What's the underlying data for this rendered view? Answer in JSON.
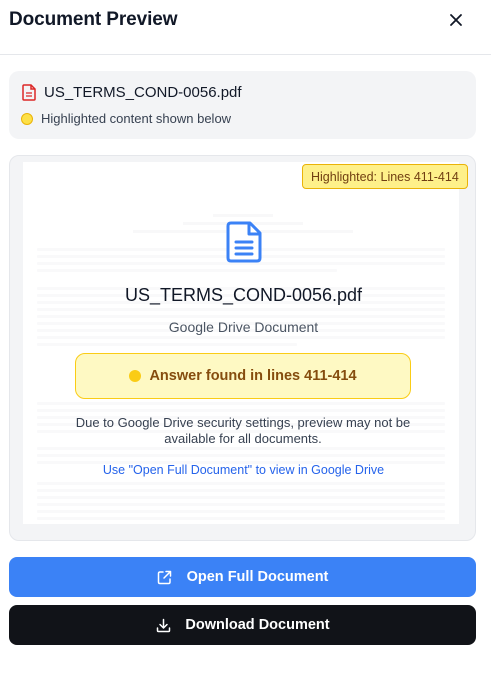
{
  "header": {
    "title": "Document Preview"
  },
  "file": {
    "name": "US_TERMS_COND-0056.pdf",
    "highlight_note": "Highlighted content shown below"
  },
  "preview": {
    "badge": "Highlighted: Lines 411-414",
    "doc_title": "US_TERMS_COND-0056.pdf",
    "doc_subtitle": "Google Drive Document",
    "answer": "Answer found in lines 411-414",
    "note": "Due to Google Drive security settings, preview may not be available for all documents.",
    "link": "Use \"Open Full Document\" to view in Google Drive"
  },
  "actions": {
    "open_label": "Open Full Document",
    "download_label": "Download Document"
  },
  "colors": {
    "primary": "#3b82f6",
    "dark": "#111318",
    "highlight": "#fef08a",
    "pdf_red": "#dc2626"
  },
  "icons": {
    "close": "close-icon",
    "file": "pdf-file-icon",
    "doc": "document-icon",
    "open": "external-link-icon",
    "download": "download-icon"
  }
}
